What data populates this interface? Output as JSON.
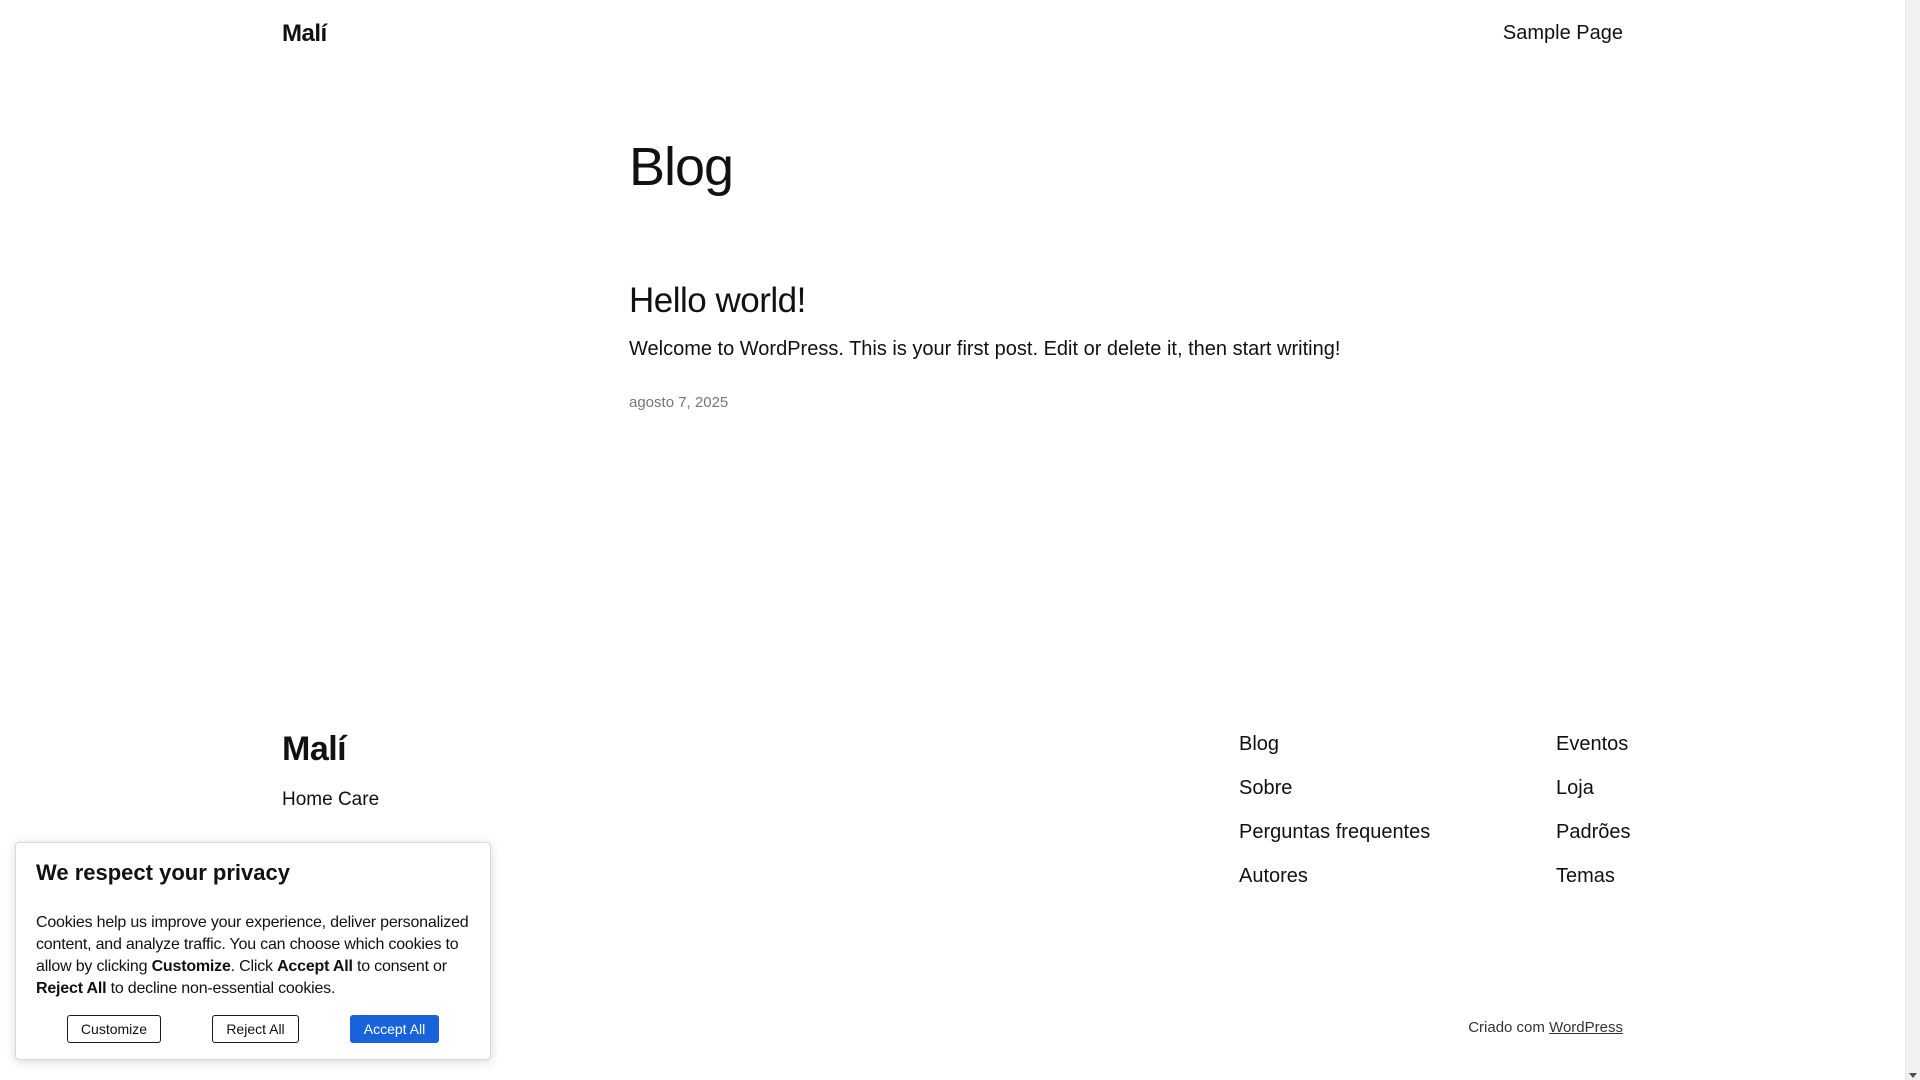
{
  "header": {
    "site_title": "Malí",
    "nav_item": "Sample Page"
  },
  "main": {
    "heading": "Blog",
    "post": {
      "title": "Hello world!",
      "excerpt": "Welcome to WordPress. This is your first post. Edit or delete it, then start writing!",
      "date": "agosto 7, 2025"
    }
  },
  "footer": {
    "logo": "Malí",
    "tagline": "Home Care",
    "column_1": [
      "Blog",
      "Sobre",
      "Perguntas frequentes",
      "Autores"
    ],
    "column_2": [
      "Eventos",
      "Loja",
      "Padrões",
      "Temas"
    ],
    "credit_prefix": "Criado com",
    "credit_link": "WordPress"
  },
  "cookie_banner": {
    "title": "We respect your privacy",
    "text_1": "Cookies help us improve your experience, deliver personalized content, and analyze traffic. You can choose which cookies to allow by clicking ",
    "text_bold_1": "Customize",
    "text_2": ". Click ",
    "text_bold_2": "Accept All",
    "text_3": " to consent or ",
    "text_bold_3": "Reject All",
    "text_4": " to decline non-essential cookies.",
    "customize_label": "Customize",
    "reject_label": "Reject All",
    "accept_label": "Accept All"
  },
  "colors": {
    "accent": "#1863dc",
    "text": "#111111",
    "muted": "#777777"
  }
}
